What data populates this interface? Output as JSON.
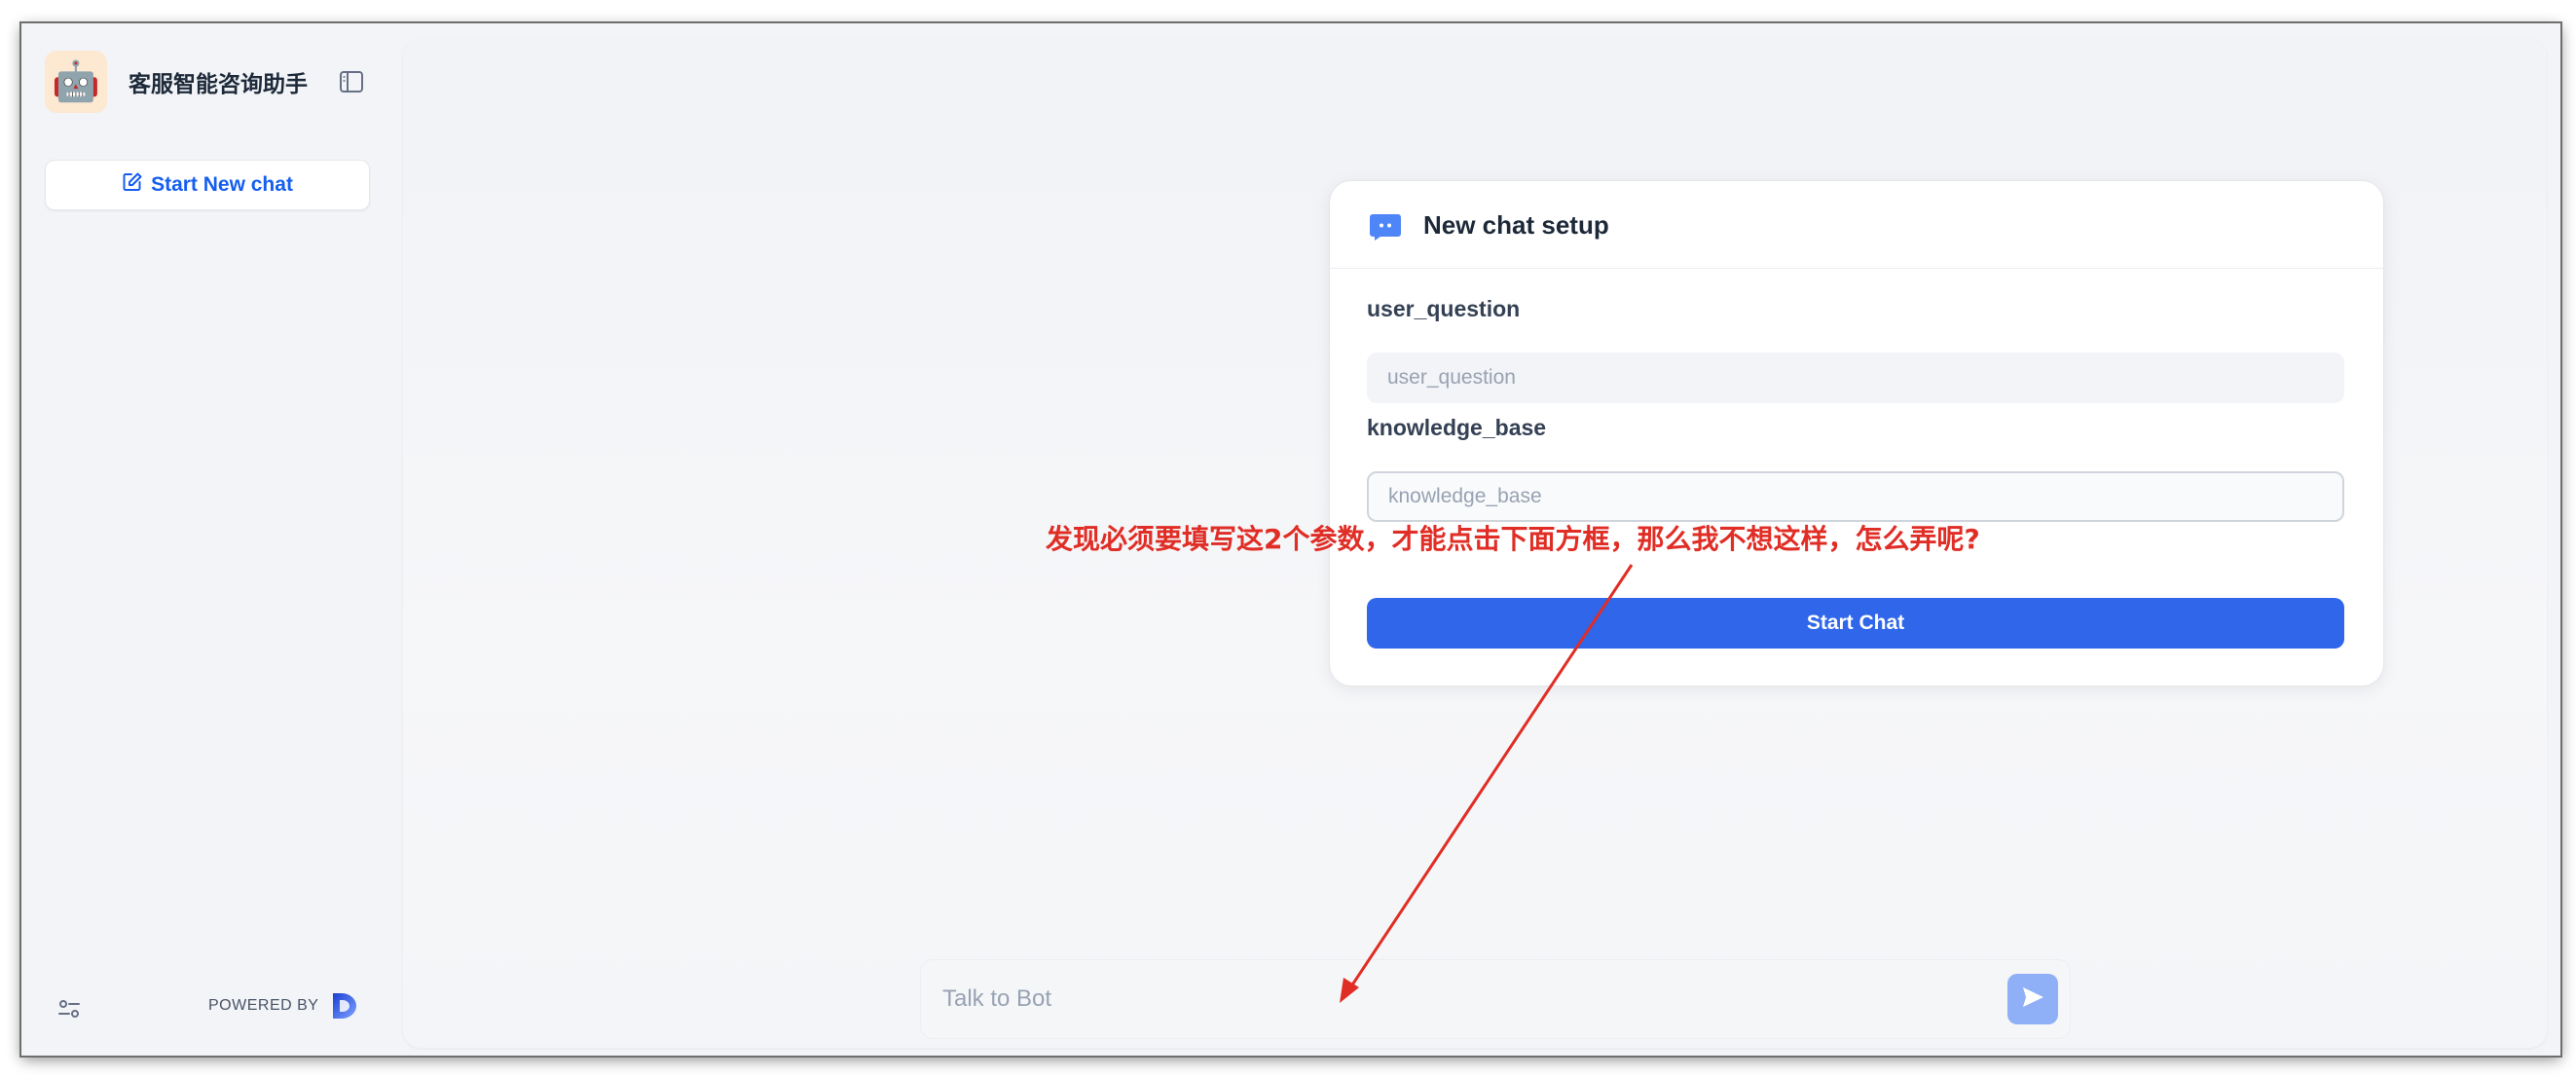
{
  "sidebar": {
    "app_name": "客服智能咨询助手",
    "avatar_emoji": "🤖",
    "new_chat_label": "Start New chat",
    "powered_by": "POWERED BY"
  },
  "setup_card": {
    "title": "New chat setup",
    "fields": [
      {
        "label": "user_question",
        "placeholder": "user_question"
      },
      {
        "label": "knowledge_base",
        "placeholder": "knowledge_base"
      }
    ],
    "start_label": "Start Chat"
  },
  "chat": {
    "placeholder": "Talk to Bot"
  },
  "annotation": {
    "text": "发现必须要填写这2个参数，才能点击下面方框，那么我不想这样，怎么弄呢?",
    "color": "#e02d25"
  },
  "colors": {
    "accent": "#2f66ea",
    "link": "#155eef",
    "send_button": "#8fb0f7"
  }
}
